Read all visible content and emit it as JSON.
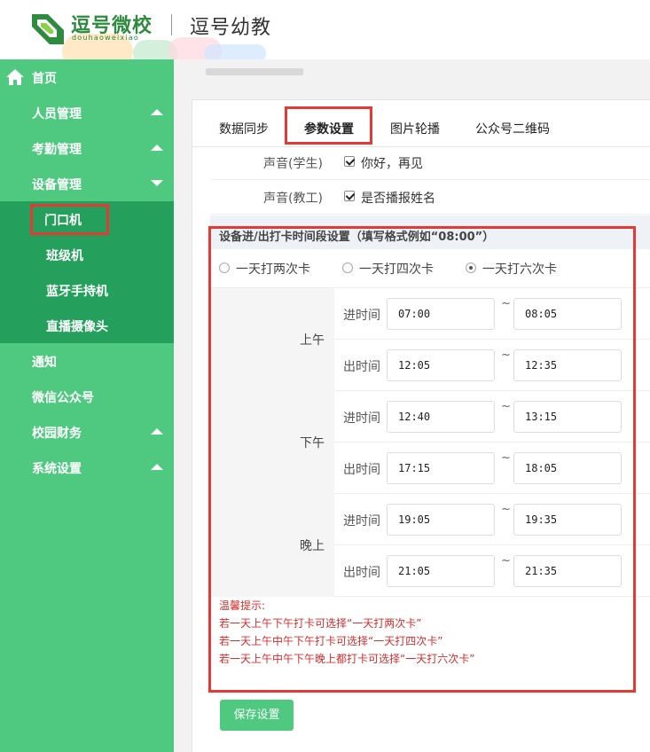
{
  "header": {
    "logo_text": "逗号微校",
    "logo_sub": "douhaoweixiao",
    "app_title": "逗号幼教"
  },
  "sidebar": {
    "home": "首页",
    "items": [
      {
        "label": "人员管理",
        "arrow": "up"
      },
      {
        "label": "考勤管理",
        "arrow": "up"
      },
      {
        "label": "设备管理",
        "arrow": "down"
      }
    ],
    "submenu": [
      "门口机",
      "班级机",
      "蓝牙手持机",
      "直播摄像头"
    ],
    "items_after": [
      {
        "label": "通知",
        "arrow": ""
      },
      {
        "label": "微信公众号",
        "arrow": ""
      },
      {
        "label": "校园财务",
        "arrow": "up"
      },
      {
        "label": "系统设置",
        "arrow": "up"
      }
    ]
  },
  "tabs": [
    "数据同步",
    "参数设置",
    "图片轮播",
    "公众号二维码"
  ],
  "settings": [
    {
      "key": "声音(学生)",
      "value": "你好，再见"
    },
    {
      "key": "声音(教工)",
      "value": "是否播报姓名"
    }
  ],
  "section": {
    "title": "设备进/出打卡时间段设置（填写格式例如“08:00”）",
    "radios": [
      {
        "label": "一天打两次卡",
        "checked": false
      },
      {
        "label": "一天打四次卡",
        "checked": false
      },
      {
        "label": "一天打六次卡",
        "checked": true
      }
    ],
    "periods": [
      {
        "label": "上午",
        "rows": [
          {
            "key": "进时间",
            "start": "07:00",
            "end": "08:05"
          },
          {
            "key": "出时间",
            "start": "12:05",
            "end": "12:35"
          }
        ]
      },
      {
        "label": "下午",
        "rows": [
          {
            "key": "进时间",
            "start": "12:40",
            "end": "13:15"
          },
          {
            "key": "出时间",
            "start": "17:15",
            "end": "18:05"
          }
        ]
      },
      {
        "label": "晚上",
        "rows": [
          {
            "key": "进时间",
            "start": "19:05",
            "end": "19:35"
          },
          {
            "key": "出时间",
            "start": "21:05",
            "end": "21:35"
          }
        ]
      }
    ],
    "tilde": "~",
    "tips": [
      "温馨提示:",
      "若一天上午下午打卡可选择“一天打两次卡”",
      "若一天上午中午下午打卡可选择“一天打四次卡”",
      "若一天上午中午下午晚上都打卡可选择“一天打六次卡”"
    ]
  },
  "save_button": "保存设置",
  "colors": {
    "sidebar": "#4ec97f",
    "submenu": "#24a05c",
    "highlight": "#e53935",
    "tips": "#d32f2f"
  }
}
